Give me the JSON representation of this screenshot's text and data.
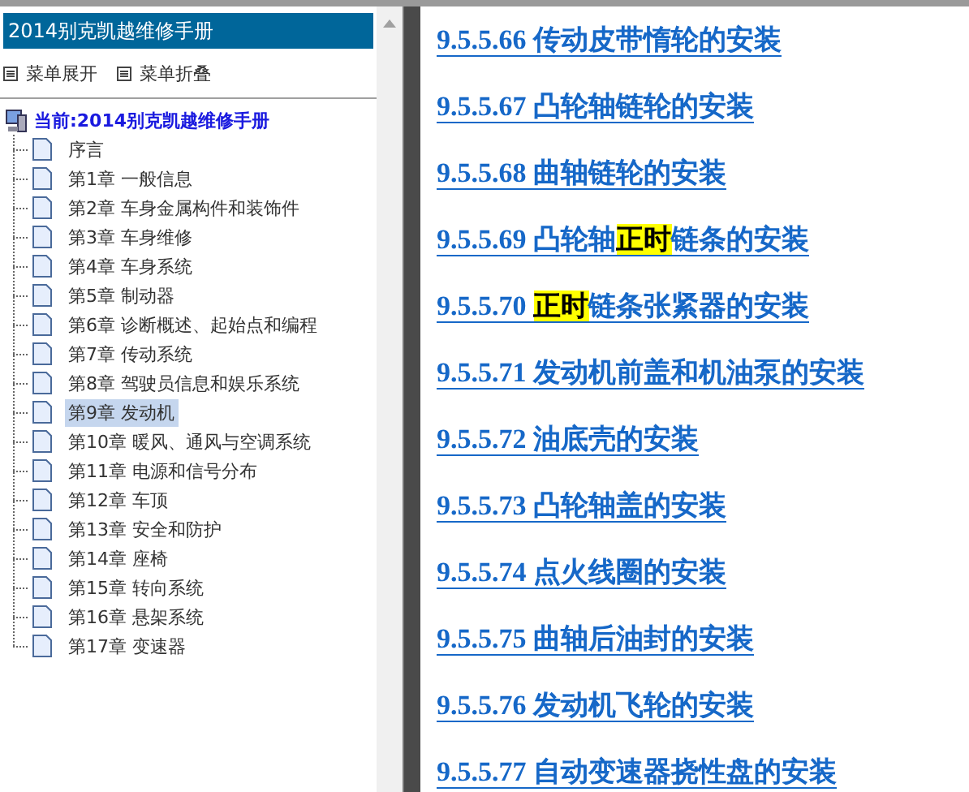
{
  "sidebar": {
    "title": "2014别克凯越维修手册",
    "menu_buttons": [
      "菜单展开",
      "菜单折叠"
    ],
    "tree": {
      "label": "当前:2014别克凯越维修手册",
      "children": [
        {
          "label": "序言",
          "selected": false
        },
        {
          "label": "第1章 一般信息",
          "selected": false
        },
        {
          "label": "第2章 车身金属构件和装饰件",
          "selected": false
        },
        {
          "label": "第3章 车身维修",
          "selected": false
        },
        {
          "label": "第4章 车身系统",
          "selected": false
        },
        {
          "label": "第5章 制动器",
          "selected": false
        },
        {
          "label": "第6章 诊断概述、起始点和编程",
          "selected": false
        },
        {
          "label": "第7章 传动系统",
          "selected": false
        },
        {
          "label": "第8章 驾驶员信息和娱乐系统",
          "selected": false
        },
        {
          "label": "第9章 发动机",
          "selected": true
        },
        {
          "label": "第10章 暖风、通风与空调系统",
          "selected": false
        },
        {
          "label": "第11章 电源和信号分布",
          "selected": false
        },
        {
          "label": "第12章 车顶",
          "selected": false
        },
        {
          "label": "第13章 安全和防护",
          "selected": false
        },
        {
          "label": "第14章 座椅",
          "selected": false
        },
        {
          "label": "第15章 转向系统",
          "selected": false
        },
        {
          "label": "第16章 悬架系统",
          "selected": false
        },
        {
          "label": "第17章 变速器",
          "selected": false
        }
      ]
    }
  },
  "content": {
    "links": [
      {
        "parts": [
          {
            "text": "9.5.5.66 传动皮带惰轮的安装",
            "highlight": false
          }
        ]
      },
      {
        "parts": [
          {
            "text": "9.5.5.67 凸轮轴链轮的安装",
            "highlight": false
          }
        ]
      },
      {
        "parts": [
          {
            "text": "9.5.5.68 曲轴链轮的安装",
            "highlight": false
          }
        ]
      },
      {
        "parts": [
          {
            "text": "9.5.5.69 凸轮轴",
            "highlight": false
          },
          {
            "text": "正时",
            "highlight": true
          },
          {
            "text": "链条的安装",
            "highlight": false
          }
        ]
      },
      {
        "parts": [
          {
            "text": "9.5.5.70 ",
            "highlight": false
          },
          {
            "text": "正时",
            "highlight": true
          },
          {
            "text": "链条张紧器的安装",
            "highlight": false
          }
        ]
      },
      {
        "parts": [
          {
            "text": "9.5.5.71 发动机前盖和机油泵的安装",
            "highlight": false
          }
        ]
      },
      {
        "parts": [
          {
            "text": "9.5.5.72 油底壳的安装",
            "highlight": false
          }
        ]
      },
      {
        "parts": [
          {
            "text": "9.5.5.73 凸轮轴盖的安装",
            "highlight": false
          }
        ]
      },
      {
        "parts": [
          {
            "text": "9.5.5.74 点火线圈的安装",
            "highlight": false
          }
        ]
      },
      {
        "parts": [
          {
            "text": "9.5.5.75 曲轴后油封的安装",
            "highlight": false
          }
        ]
      },
      {
        "parts": [
          {
            "text": "9.5.5.76 发动机飞轮的安装",
            "highlight": false
          }
        ]
      },
      {
        "parts": [
          {
            "text": "9.5.5.77 自动变速器挠性盘的安装",
            "highlight": false
          }
        ]
      }
    ]
  }
}
